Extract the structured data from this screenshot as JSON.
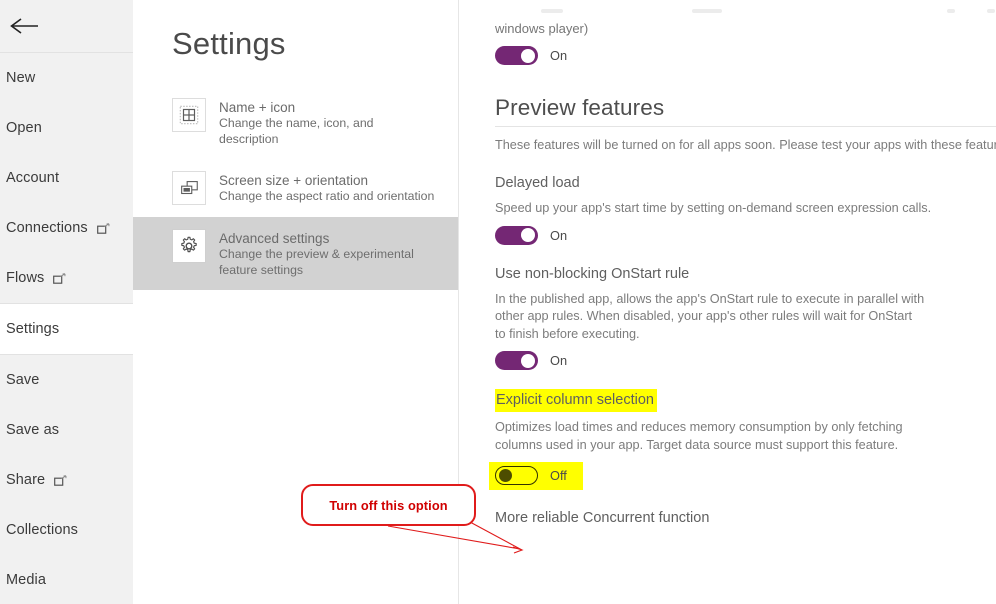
{
  "rail": {
    "back_icon": "back-arrow-icon",
    "items": [
      {
        "label": "New",
        "external": false,
        "selected": false
      },
      {
        "label": "Open",
        "external": false,
        "selected": false
      },
      {
        "label": "Account",
        "external": false,
        "selected": false
      },
      {
        "label": "Connections",
        "external": true,
        "selected": false
      },
      {
        "label": "Flows",
        "external": true,
        "selected": false
      },
      {
        "label": "Settings",
        "external": false,
        "selected": true
      },
      {
        "label": "Save",
        "external": false,
        "selected": false
      },
      {
        "label": "Save as",
        "external": false,
        "selected": false
      },
      {
        "label": "Share",
        "external": true,
        "selected": false
      },
      {
        "label": "Collections",
        "external": false,
        "selected": false
      },
      {
        "label": "Media",
        "external": false,
        "selected": false
      }
    ]
  },
  "settings": {
    "title": "Settings",
    "categories": [
      {
        "title": "Name + icon",
        "subtitle": "Change the name, icon, and description",
        "icon": "grid-icon",
        "selected": false
      },
      {
        "title": "Screen size + orientation",
        "subtitle": "Change the aspect ratio and orientation",
        "icon": "screen-size-icon",
        "selected": false
      },
      {
        "title": "Advanced settings",
        "subtitle": "Change the preview & experimental feature settings",
        "icon": "gear-icon",
        "selected": true
      }
    ]
  },
  "detail": {
    "cut_text": "windows player)",
    "top_toggle": {
      "state_label": "On",
      "state": "on"
    },
    "section": {
      "heading": "Preview features",
      "description": "These features will be turned on for all apps soon. Please test your apps with these features e"
    },
    "features": [
      {
        "title": "Delayed load",
        "description": "Speed up your app's start time by setting on-demand screen expression calls.",
        "state_label": "On",
        "state": "on",
        "highlight_title": false,
        "highlight_toggle": false
      },
      {
        "title": "Use non-blocking OnStart rule",
        "description": "In the published app, allows the app's OnStart rule to execute in parallel with other app rules. When disabled, your app's other rules will wait for OnStart to finish before executing.",
        "state_label": "On",
        "state": "on",
        "highlight_title": false,
        "highlight_toggle": false
      },
      {
        "title": "Explicit column selection",
        "description": "Optimizes load times and reduces memory consumption by only fetching columns used in your app. Target data source must support this feature.",
        "state_label": "Off",
        "state": "off",
        "highlight_title": true,
        "highlight_toggle": true
      }
    ],
    "last_feature_title": "More reliable Concurrent function"
  },
  "annotation": {
    "text": "Turn off this option",
    "color": "#d00000"
  },
  "colors": {
    "toggle_on": "#742774",
    "highlight": "#ffff00",
    "rail_background": "#f1f1f1",
    "selected_category": "#d2d2d2",
    "annotation_red": "#e01b1b"
  }
}
